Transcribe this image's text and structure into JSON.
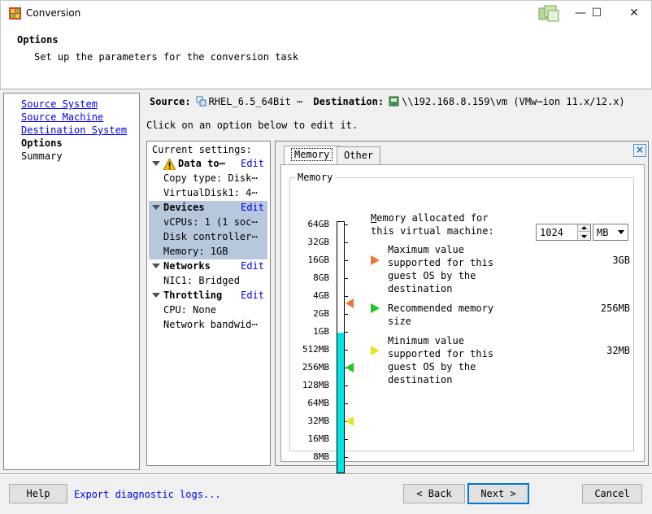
{
  "window": {
    "title": "Conversion",
    "minimize": "—",
    "maximize": "☐",
    "close": "✕"
  },
  "header": {
    "title": "Options",
    "subtitle": "Set up the parameters for the conversion task"
  },
  "nav": {
    "items": [
      {
        "label": "Source System",
        "link": true
      },
      {
        "label": "Source Machine",
        "link": true
      },
      {
        "label": "Destination System",
        "link": true
      },
      {
        "label": "Options",
        "link": false,
        "current": true
      },
      {
        "label": "Summary",
        "link": false
      }
    ]
  },
  "summary": {
    "source_label": "Source:",
    "source_value": "RHEL_6.5_64Bit ⋯",
    "destination_label": "Destination:",
    "destination_value": "\\\\192.168.8.159\\vm (VMw⋯ion 11.x/12.x)",
    "instruction": "Click on an option below to edit it."
  },
  "settings": {
    "title": "Current settings:",
    "edit_label": "Edit",
    "groups": [
      {
        "name": "Data to⋯",
        "warning": true,
        "selected": false,
        "items": [
          "Copy type: Disk⋯",
          "VirtualDisk1: 4⋯"
        ]
      },
      {
        "name": "Devices",
        "warning": false,
        "selected": true,
        "items": [
          "vCPUs: 1 (1 soc⋯",
          "Disk controller⋯",
          "Memory: 1GB"
        ]
      },
      {
        "name": "Networks",
        "warning": false,
        "selected": false,
        "items": [
          "NIC1: Bridged"
        ]
      },
      {
        "name": "Throttling",
        "warning": false,
        "selected": false,
        "items": [
          "CPU: None",
          "Network bandwid⋯"
        ]
      }
    ]
  },
  "tabs": [
    {
      "label": "Memory",
      "active": true
    },
    {
      "label": "Other",
      "active": false
    }
  ],
  "memory": {
    "group_label": "Memory",
    "allocated_label": "Memory allocated for this virtual machine:",
    "value": "1024",
    "unit": "MB",
    "scale": [
      "64GB",
      "32GB",
      "16GB",
      "8GB",
      "4GB",
      "2GB",
      "1GB",
      "512MB",
      "256MB",
      "128MB",
      "64MB",
      "32MB",
      "16MB",
      "8MB"
    ],
    "filled_level": "1GB",
    "legend": [
      {
        "label": "Maximum value supported for this guest OS by the destination",
        "value": "3GB",
        "color": "#e8783c"
      },
      {
        "label": "Recommended memory size",
        "value": "256MB",
        "color": "#22c322"
      },
      {
        "label": "Minimum value supported for this guest OS by the destination",
        "value": "32MB",
        "color": "#e6e61e"
      }
    ],
    "bar_color": "#00e6e6"
  },
  "footer": {
    "help": "Help",
    "diagnostic": "Export diagnostic logs...",
    "back": "< Back",
    "next": "Next >",
    "cancel": "Cancel"
  }
}
